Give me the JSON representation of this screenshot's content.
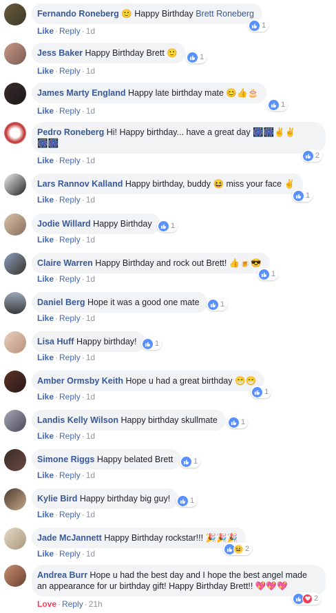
{
  "colors": {
    "link": "#385898",
    "action": "#4267b2",
    "meta": "#90949c",
    "bubble": "#f2f3f5",
    "like": "#5890ff",
    "love": "#f33e58"
  },
  "comments": [
    {
      "name": "Fernando Roneberg",
      "text": " 🙂 Happy Birthday ",
      "tag": "Brett Roneberg",
      "text2": "",
      "action": "Like",
      "reply": "Reply",
      "time": "1d",
      "count": "1"
    },
    {
      "name": "Jess Baker",
      "text": " Happy Birthday Brett 🙂",
      "action": "Like",
      "reply": "Reply",
      "time": "1d",
      "count": "1"
    },
    {
      "name": "James Marty England",
      "text": " Happy late birthday mate 😊👍🎂",
      "action": "Like",
      "reply": "Reply",
      "time": "1d",
      "count": "1"
    },
    {
      "name": "Pedro Roneberg",
      "text": " Hi! Happy birthday... have a great day 🎆🎆✌✌",
      "line2": "🎆🎆",
      "action": "Like",
      "reply": "Reply",
      "time": "1d",
      "count": "2"
    },
    {
      "name": "Lars Rannov Kalland",
      "text": " Happy birthday, buddy 😆 miss your face ✌",
      "action": "Like",
      "reply": "Reply",
      "time": "1d",
      "count": "1"
    },
    {
      "name": "Jodie Willard",
      "text": " Happy Birthday",
      "action": "Like",
      "reply": "Reply",
      "time": "1d",
      "count": "1"
    },
    {
      "name": "Claire Warren",
      "text": " Happy Birthday and rock out Brett! 👍🍺😎",
      "action": "Like",
      "reply": "Reply",
      "time": "1d",
      "count": "1"
    },
    {
      "name": "Daniel Berg",
      "text": " Hope it was a good one mate",
      "action": "Like",
      "reply": "Reply",
      "time": "1d",
      "count": "1"
    },
    {
      "name": "Lisa Huff",
      "text": " Happy birthday!",
      "action": "Like",
      "reply": "Reply",
      "time": "1d",
      "count": "1"
    },
    {
      "name": "Amber Ormsby Keith",
      "text": " Hope u had a great birthday 😁😁",
      "action": "Like",
      "reply": "Reply",
      "time": "1d",
      "count": "1"
    },
    {
      "name": "Landis Kelly Wilson",
      "text": " Happy birthday skullmate",
      "action": "Like",
      "reply": "Reply",
      "time": "1d",
      "count": "1"
    },
    {
      "name": "Simone Riggs",
      "text": " Happy belated Brett",
      "action": "Like",
      "reply": "Reply",
      "time": "1d",
      "count": "1"
    },
    {
      "name": "Kylie Bird",
      "text": " Happy birthday big guy!",
      "action": "Like",
      "reply": "Reply",
      "time": "1d",
      "count": "1"
    },
    {
      "name": "Jade McJannett",
      "text": " Happy Birthday rockstar!!! 🎉🎉🎉",
      "action": "Like",
      "reply": "Reply",
      "time": "1d",
      "count": "2"
    },
    {
      "name": "Andrea Burr",
      "text": " Hope u had the best day and I hope the best angel made",
      "line2": "an appearance for ur birthday gift! Happy Birthday Brett!! 💖💖💖",
      "action": "Love",
      "reply": "Reply",
      "time": "21h",
      "count": "2"
    }
  ]
}
